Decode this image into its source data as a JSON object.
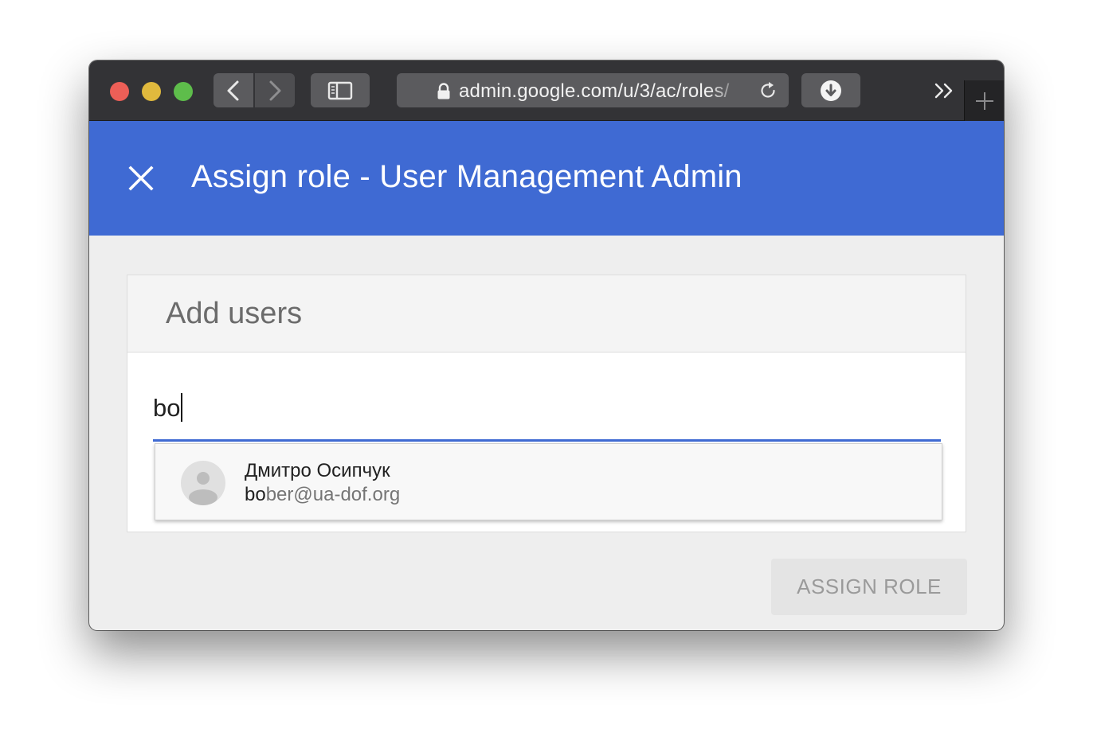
{
  "browser": {
    "url": "admin.google.com/u/3/ac/roles/",
    "icons": {
      "back": "chevron-left-icon",
      "forward": "chevron-right-icon",
      "sidebar": "sidebar-icon",
      "lock": "lock-icon",
      "reload": "reload-icon",
      "download": "download-icon",
      "overflow": "double-chevron-right-icon",
      "new_tab": "plus-icon"
    }
  },
  "header": {
    "title": "Assign role - User Management Admin",
    "background_color": "#3f6ad3",
    "close_icon": "close-icon"
  },
  "add_users": {
    "title": "Add users",
    "search_value": "bo",
    "suggestions": [
      {
        "name": "Дмитро Осипчук",
        "email_match": "bo",
        "email_rest": "ber@ua-dof.org",
        "avatar_icon": "person-icon"
      }
    ]
  },
  "actions": {
    "assign_role_label": "ASSIGN ROLE"
  }
}
